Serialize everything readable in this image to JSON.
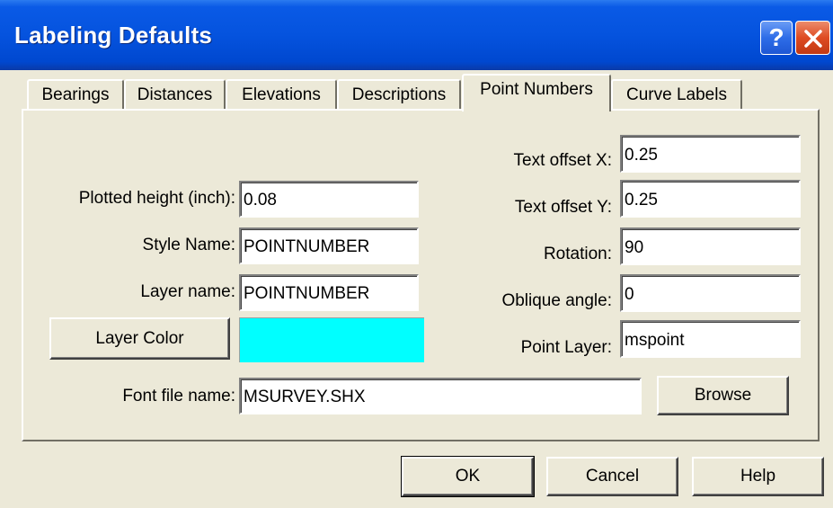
{
  "window": {
    "title": "Labeling Defaults",
    "help_glyph": "?"
  },
  "tabs": [
    {
      "label": "Bearings"
    },
    {
      "label": "Distances"
    },
    {
      "label": "Elevations"
    },
    {
      "label": "Descriptions"
    },
    {
      "label": "Point Numbers",
      "active": true
    },
    {
      "label": "Curve Labels"
    }
  ],
  "form": {
    "plotted_height": {
      "label": "Plotted height (inch):",
      "value": "0.08"
    },
    "style_name": {
      "label": "Style Name:",
      "value": "POINTNUMBER"
    },
    "layer_name": {
      "label": "Layer name:",
      "value": "POINTNUMBER"
    },
    "layer_color": {
      "button_label": "Layer Color",
      "color": "#00ffff"
    },
    "font_file": {
      "label": "Font file name:",
      "value": "MSURVEY.SHX"
    },
    "browse_label": "Browse",
    "text_offset_x": {
      "label": "Text offset X:",
      "value": "0.25"
    },
    "text_offset_y": {
      "label": "Text offset Y:",
      "value": "0.25"
    },
    "rotation": {
      "label": "Rotation:",
      "value": "90"
    },
    "oblique_angle": {
      "label": "Oblique angle:",
      "value": "0"
    },
    "point_layer": {
      "label": "Point Layer:",
      "value": "mspoint"
    }
  },
  "buttons": {
    "ok": "OK",
    "cancel": "Cancel",
    "help": "Help"
  },
  "colors": {
    "titlebar": "#0553de",
    "dialog_bg": "#ece9d8",
    "layer_color_swatch": "#00ffff"
  }
}
